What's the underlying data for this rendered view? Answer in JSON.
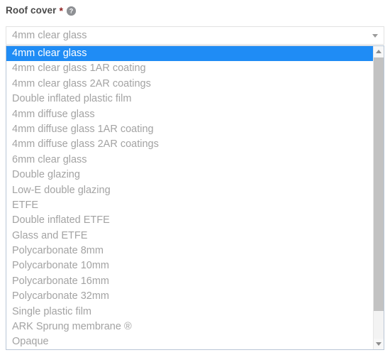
{
  "field": {
    "label": "Roof cover",
    "required_marker": "*",
    "help_icon": "help-circle-icon",
    "help_glyph": "?",
    "accent_color": "#1f8cf5",
    "required_color": "#8f2020",
    "label_color": "#4b4b4b",
    "option_text_color": "#a3a3a3"
  },
  "select": {
    "value": "4mm clear glass",
    "caret_icon": "chevron-down-icon",
    "expanded": true
  },
  "options": [
    {
      "label": "4mm clear glass",
      "selected": true
    },
    {
      "label": "4mm clear glass 1AR coating",
      "selected": false
    },
    {
      "label": "4mm clear glass 2AR coatings",
      "selected": false
    },
    {
      "label": "Double inflated plastic film",
      "selected": false
    },
    {
      "label": "4mm diffuse glass",
      "selected": false
    },
    {
      "label": "4mm diffuse glass 1AR coating",
      "selected": false
    },
    {
      "label": "4mm diffuse glass 2AR coatings",
      "selected": false
    },
    {
      "label": "6mm clear glass",
      "selected": false
    },
    {
      "label": "Double glazing",
      "selected": false
    },
    {
      "label": "Low-E double glazing",
      "selected": false
    },
    {
      "label": "ETFE",
      "selected": false
    },
    {
      "label": "Double inflated ETFE",
      "selected": false
    },
    {
      "label": "Glass and ETFE",
      "selected": false
    },
    {
      "label": "Polycarbonate 8mm",
      "selected": false
    },
    {
      "label": "Polycarbonate 10mm",
      "selected": false
    },
    {
      "label": "Polycarbonate 16mm",
      "selected": false
    },
    {
      "label": "Polycarbonate 32mm",
      "selected": false
    },
    {
      "label": "Single plastic film",
      "selected": false
    },
    {
      "label": "ARK Sprung membrane ®",
      "selected": false
    },
    {
      "label": "Opaque",
      "selected": false
    }
  ],
  "scrollbar": {
    "up_arrow_icon": "scroll-up-arrow-icon",
    "down_arrow_icon": "scroll-down-arrow-icon",
    "thumb_label": "scrollbar-thumb"
  }
}
